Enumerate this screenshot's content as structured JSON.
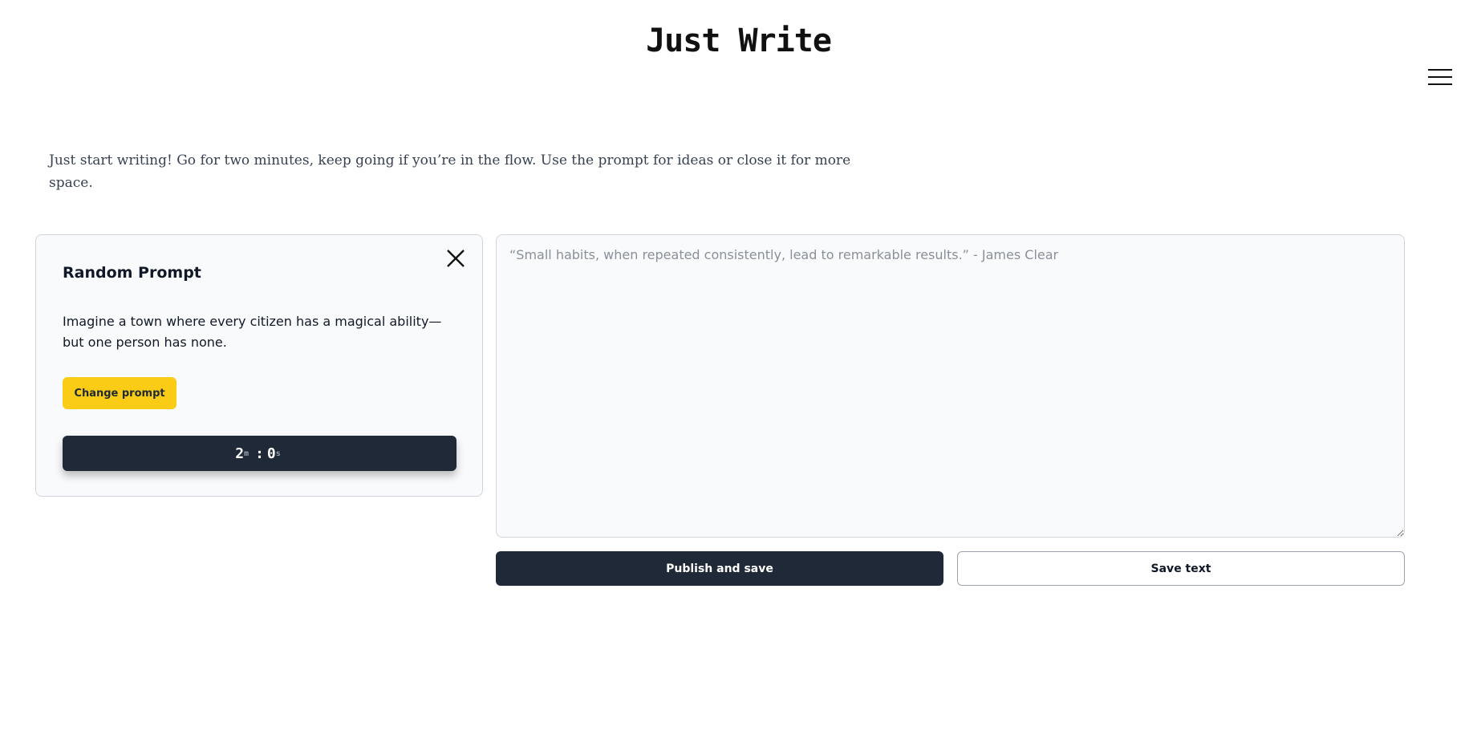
{
  "header": {
    "title": "Just Write",
    "menu_icon": "hamburger-menu-icon"
  },
  "intro": {
    "text": "Just start writing! Go for two minutes, keep going if you’re in the flow. Use the prompt for ideas or close it for more space."
  },
  "prompt_card": {
    "heading": "Random Prompt",
    "prompt": "Imagine a town where every citizen has a magical ability—but one person has none.",
    "change_button": "Change prompt",
    "close_icon": "close-icon",
    "timer": {
      "minutes": "2",
      "minutes_unit": "m",
      "separator": ":",
      "seconds": "0",
      "seconds_unit": "s"
    }
  },
  "editor": {
    "value": "",
    "placeholder": "“Small habits, when repeated consistently, lead to remarkable results.” - James Clear"
  },
  "actions": {
    "publish_label": "Publish and save",
    "save_label": "Save text"
  },
  "colors": {
    "accent": "#facc15",
    "dark": "#1f2937",
    "panel_bg": "#f9fafb",
    "border": "#d1d5db"
  }
}
